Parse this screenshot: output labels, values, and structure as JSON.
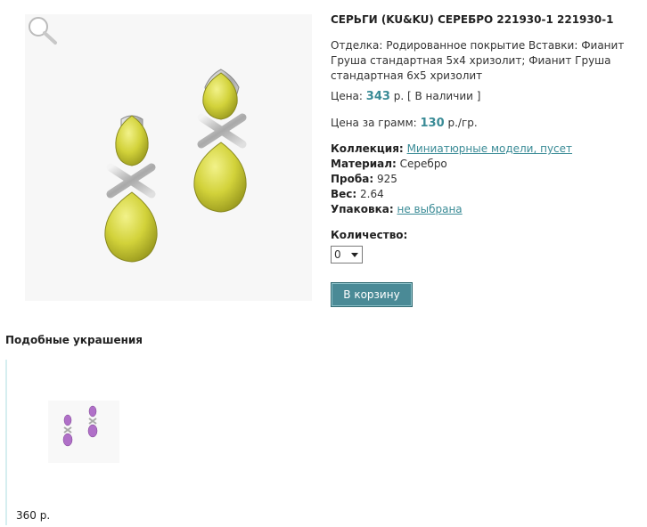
{
  "product": {
    "title": "СЕРЬГИ (KU&KU) СЕРЕБРО 221930-1 221930-1",
    "finish": "Отделка: Родированное покрытие Вставки: Фианит Груша стандартная 5х4 хризолит; Фианит Груша стандартная 6х5 хризолит",
    "price_label": "Цена:",
    "price_value": "343",
    "price_unit": "р.",
    "availability": "[ В наличии ]",
    "gram_label": "Цена за грамм:",
    "gram_value": "130",
    "gram_unit": "р./гр.",
    "specs": {
      "collection_label": "Коллекция:",
      "collection_value": "Миниатюрные модели, пусет",
      "material_label": "Материал:",
      "material_value": "Серебро",
      "proba_label": "Проба:",
      "proba_value": "925",
      "weight_label": "Вес:",
      "weight_value": "2.64",
      "pack_label": "Упаковка:",
      "pack_value": "не выбрана"
    },
    "quantity_label": "Количество:",
    "quantity_value": "0",
    "cart_button": "В корзину"
  },
  "similar": {
    "title": "Подобные украшения",
    "items": [
      {
        "price": "360 р."
      }
    ]
  },
  "colors": {
    "accent": "#3a8b96",
    "button": "#4a8a96",
    "stone_yellow": "#d4d43a",
    "stone_pink": "#b070c8"
  },
  "icons": [
    "zoom-icon",
    "dropdown-arrow-icon"
  ]
}
